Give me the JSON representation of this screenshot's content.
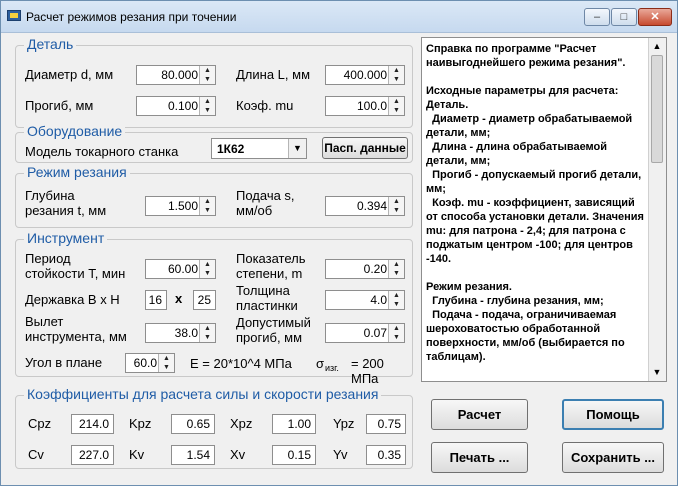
{
  "window": {
    "title": "Расчет режимов резания при точении",
    "minimize": "‒",
    "maximize": "□",
    "close": "✕"
  },
  "detail": {
    "legend": "Деталь",
    "diameter_label": "Диаметр d, мм",
    "diameter_value": "80.000",
    "length_label": "Длина L, мм",
    "length_value": "400.000",
    "deflection_label": "Прогиб, мм",
    "deflection_value": "0.100",
    "mu_label": "Коэф. mu",
    "mu_value": "100.0"
  },
  "equipment": {
    "legend": "Оборудование",
    "lathe_label": "Модель токарного станка",
    "lathe_value": "1К62",
    "passport_button": "Пасп. данные"
  },
  "cutting_mode": {
    "legend": "Режим резания",
    "depth_label_1": "Глубина",
    "depth_label_2": "резания t, мм",
    "depth_value": "1.500",
    "feed_label_1": "Подача s,",
    "feed_label_2": "мм/об",
    "feed_value": "0.394"
  },
  "tool": {
    "legend": "Инструмент",
    "period_label_1": "Период",
    "period_label_2": "стойкости T, мин",
    "period_value": "60.00",
    "exponent_label_1": "Показатель",
    "exponent_label_2": "степени, m",
    "exponent_value": "0.20",
    "holder_label": "Державка B x H",
    "holder_b": "16",
    "holder_x": "x",
    "holder_h": "25",
    "thickness_label_1": "Толщина",
    "thickness_label_2": "пластинки",
    "thickness_value": "4.0",
    "overhang_label_1": "Вылет",
    "overhang_label_2": "инструмента, мм",
    "overhang_value": "38.0",
    "allowed_label_1": "Допустимый",
    "allowed_label_2": "прогиб, мм",
    "allowed_value": "0.07",
    "angle_label": "Угол в плане",
    "angle_value": "60.0",
    "modulus_text": "E = 20*10^4 МПа",
    "sigma_text": "σ",
    "sigma_sub": "изг.",
    "sigma_value": "= 200 МПа"
  },
  "coefficients": {
    "legend": "Коэффициенты для расчета силы и скорости резания",
    "row1": [
      {
        "label": "Cpz",
        "value": "214.0"
      },
      {
        "label": "Kpz",
        "value": "0.65"
      },
      {
        "label": "Xpz",
        "value": "1.00"
      },
      {
        "label": "Ypz",
        "value": "0.75"
      }
    ],
    "row2": [
      {
        "label": "Cv",
        "value": "227.0"
      },
      {
        "label": "Kv",
        "value": "1.54"
      },
      {
        "label": "Xv",
        "value": "0.15"
      },
      {
        "label": "Yv",
        "value": "0.35"
      }
    ]
  },
  "help": {
    "text": "Справка по программе \"Расчет наивыгоднейшего режима резания\".\n\nИсходные параметры для расчета:\nДеталь.\n  Диаметр - диаметр обрабатываемой детали, мм;\n  Длина - длина обрабатываемой детали, мм;\n  Прогиб - допускаемый прогиб детали, мм;\n  Коэф. mu - коэффициент, зависящий от способа установки детали. Значения mu: для патрона - 2,4; для патрона с поджатым центром -100; для центров -140.\n\nРежим резания.\n  Глубина - глубина резания, мм;\n  Подача - подача, ограничиваемая шероховатостью обработанной поверхности, мм/об (выбирается по таблицам)."
  },
  "buttons": {
    "calculate": "Расчет",
    "help": "Помощь",
    "print": "Печать ...",
    "save": "Сохранить ..."
  },
  "colors": {
    "legend_text": "#1f5ca6",
    "title_bar": "#c6d9ef",
    "close_button": "#c74a2f"
  }
}
